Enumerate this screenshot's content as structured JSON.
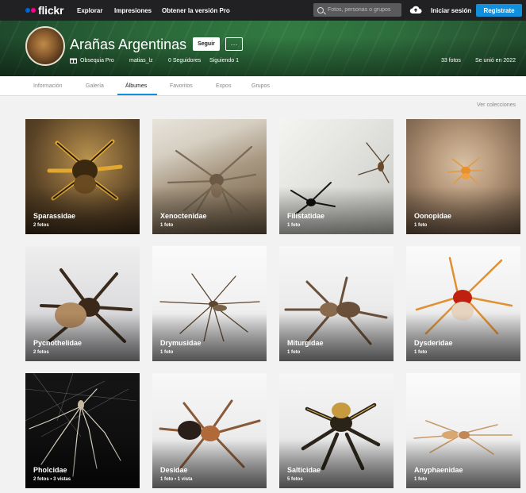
{
  "nav": {
    "logo": "flickr",
    "explore": "Explorar",
    "prints": "Impresiones",
    "get_pro": "Obtener la versión Pro",
    "search_placeholder": "Fotos, personas o grupos",
    "login": "Iniciar sesión",
    "signup": "Regístrate"
  },
  "profile": {
    "title": "Arañas Argentinas",
    "follow": "Seguir",
    "more": "···",
    "pro_label": "Obsequia Pro",
    "username": "matias_lz",
    "followers": "0 Seguidores",
    "following": "Siguiendo 1",
    "photos": "33 fotos",
    "joined": "Se unió en 2022"
  },
  "tabs": [
    {
      "label": "Información"
    },
    {
      "label": "Galería"
    },
    {
      "label": "Álbumes"
    },
    {
      "label": "Favoritos"
    },
    {
      "label": "Expos"
    },
    {
      "label": "Grupos"
    }
  ],
  "active_tab": "Álbumes",
  "view_collections": "Ver colecciones",
  "albums": [
    {
      "name": "Sparassidae",
      "count": "2 fotos"
    },
    {
      "name": "Xenoctenidae",
      "count": "1 foto"
    },
    {
      "name": "Filistatidae",
      "count": "1 foto"
    },
    {
      "name": "Oonopidae",
      "count": "1 foto"
    },
    {
      "name": "Pycnothelidae",
      "count": "2 fotos"
    },
    {
      "name": "Drymusidae",
      "count": "1 foto"
    },
    {
      "name": "Miturgidae",
      "count": "1 foto"
    },
    {
      "name": "Dysderidae",
      "count": "1 foto"
    },
    {
      "name": "Pholcidae",
      "count": "2 fotos  •  3 vistas"
    },
    {
      "name": "Desidae",
      "count": "1 foto  •  1 vista"
    },
    {
      "name": "Salticidae",
      "count": "5 fotos"
    },
    {
      "name": "Anyphaenidae",
      "count": "1 foto"
    }
  ],
  "colors": {
    "topbar": "#212124",
    "accent": "#128fdc",
    "logo_blue": "#0063dc",
    "logo_pink": "#ff0084"
  }
}
